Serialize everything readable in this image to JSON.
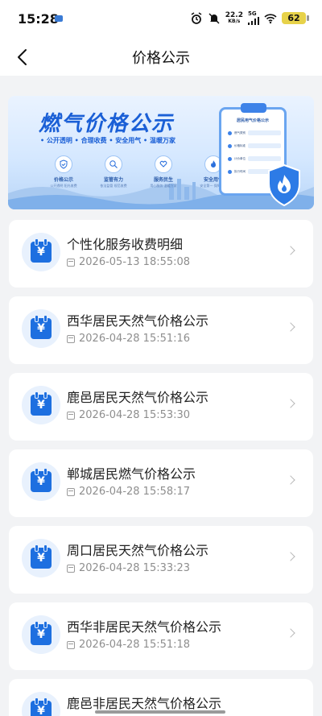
{
  "status_bar": {
    "time": "15:28",
    "net_speed_value": "22.2",
    "net_speed_unit": "KB/s",
    "network": "5G",
    "battery": "62"
  },
  "nav": {
    "title": "价格公示"
  },
  "banner": {
    "title": "燃气价格公示",
    "subtitle": "• 公开透明 • 合理收费 • 安全用气 • 温暖万家",
    "features": [
      {
        "label": "价格公示",
        "desc": "公开透明 阳光收费"
      },
      {
        "label": "监管有力",
        "desc": "依法监管 规范收费"
      },
      {
        "label": "服务民生",
        "desc": "用心服务 温暖万家"
      },
      {
        "label": "安全用气",
        "desc": "安全第一 保障生活"
      }
    ],
    "clipboard_title": "居民用气价格公示",
    "clipboard_rows": [
      "燃气类别",
      "价格标准",
      "计价单位",
      "执行时间"
    ]
  },
  "list": {
    "items": [
      {
        "title": "个性化服务收费明细",
        "time": "2026-05-13 18:55:08"
      },
      {
        "title": "西华居民天然气价格公示",
        "time": "2026-04-28 15:51:16"
      },
      {
        "title": "鹿邑居民天然气价格公示",
        "time": "2026-04-28 15:53:30"
      },
      {
        "title": "郸城居民燃气价格公示",
        "time": "2026-04-28 15:58:17"
      },
      {
        "title": "周口居民天然气价格公示",
        "time": "2026-04-28 15:33:23"
      },
      {
        "title": "西华非居民天然气价格公示",
        "time": "2026-04-28 15:51:18"
      },
      {
        "title": "鹿邑非居民天然气价格公示",
        "time": ""
      }
    ],
    "icon_glyph": "¥"
  },
  "colors": {
    "accent": "#1d6fe0",
    "background": "#f2f3f5",
    "card": "#ffffff"
  }
}
